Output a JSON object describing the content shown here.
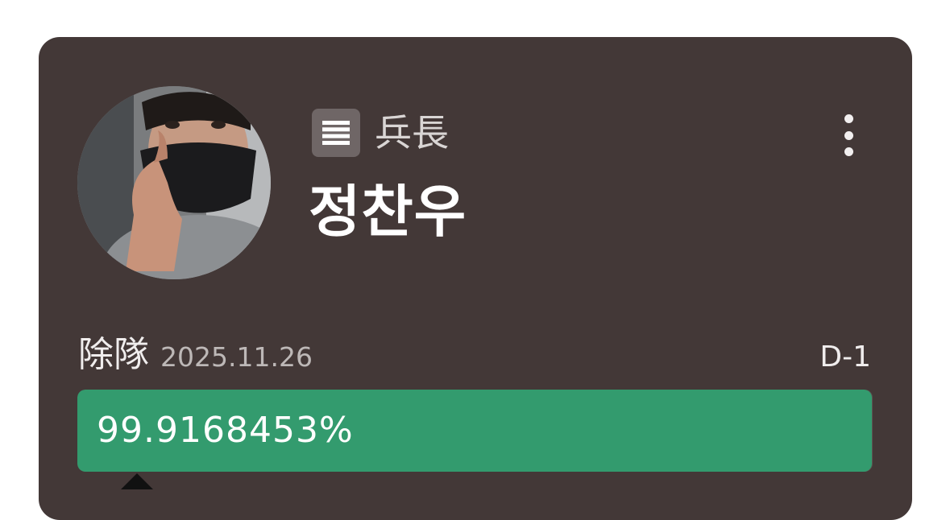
{
  "profile": {
    "avatar_alt": "profile-photo",
    "rank": "兵長",
    "rank_icon": "list-icon",
    "name": "정찬우",
    "menu_icon": "more-vertical-icon"
  },
  "discharge": {
    "label": "除隊",
    "date": "2025.11.26",
    "dday": "D-1"
  },
  "progress": {
    "value": 99.9168453,
    "text": "99.9168453%",
    "fill_color": "#339b6e"
  },
  "colors": {
    "card_bg": "#433837",
    "accent": "#339b6e"
  }
}
